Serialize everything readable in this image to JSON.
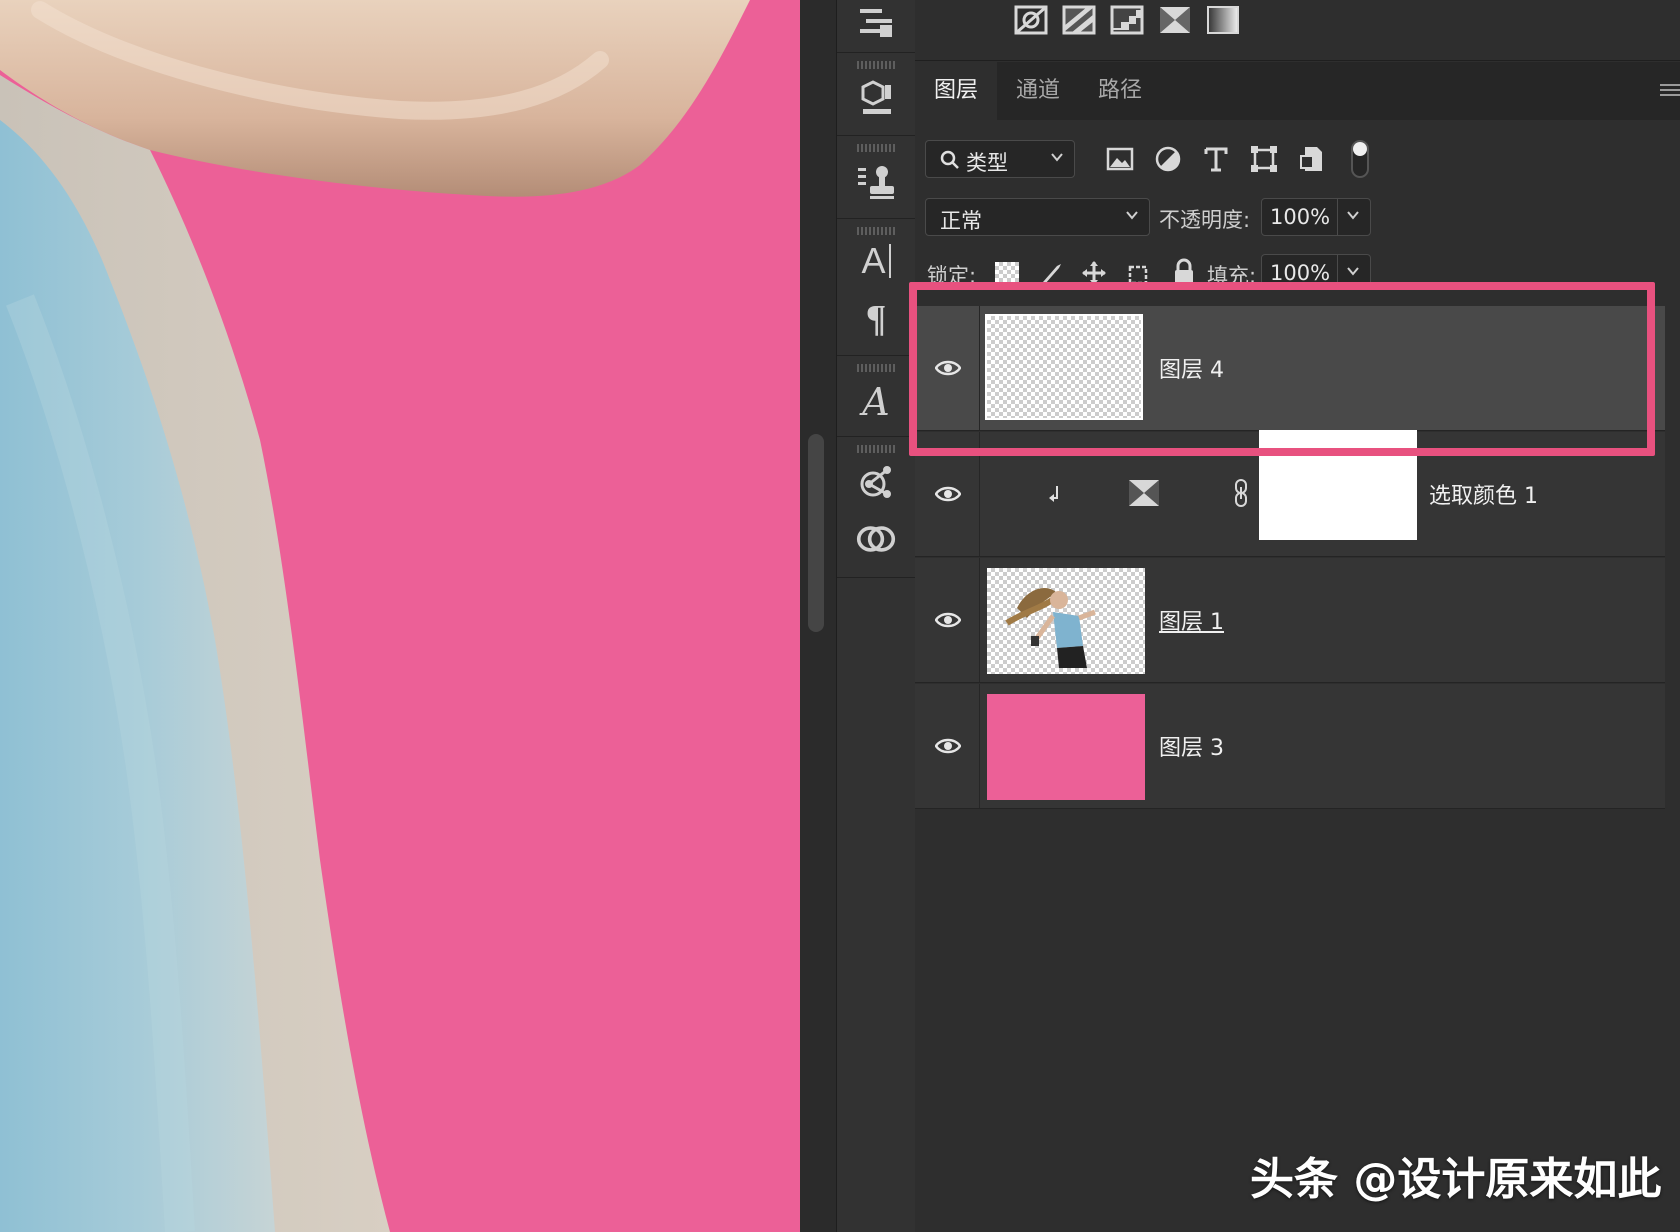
{
  "colors": {
    "canvas_bg": "#ec6097",
    "highlight": "#e8517f",
    "panel_bg": "#2e2e2e"
  },
  "adjustment_icons": [
    "exposure-icon",
    "gradient-map-icon",
    "posterize-icon",
    "channel-mixer-icon",
    "gradient-fill-icon"
  ],
  "tool_strip": [
    "properties-icon",
    "3d-icon",
    "clone-source-icon",
    "character-icon",
    "paragraph-icon",
    "glyphs-icon",
    "share-icon",
    "creative-cloud-icon"
  ],
  "tabs": {
    "layers": "图层",
    "channels": "通道",
    "paths": "路径"
  },
  "filter": {
    "kind_label": "类型",
    "icons": [
      "image-filter-icon",
      "adjustment-filter-icon",
      "type-filter-icon",
      "shape-filter-icon",
      "smart-object-filter-icon"
    ]
  },
  "blend": {
    "mode": "正常",
    "opacity_label": "不透明度:",
    "opacity_value": "100%"
  },
  "lock": {
    "lock_label": "锁定:",
    "fill_label": "填充:",
    "fill_value": "100%"
  },
  "layers": [
    {
      "name": "图层 4",
      "visible": true,
      "selected": true,
      "type": "empty"
    },
    {
      "name": "选取颜色 1",
      "visible": true,
      "selected": false,
      "type": "adjustment",
      "clipped": true
    },
    {
      "name": "图层 1",
      "visible": true,
      "selected": false,
      "type": "photo"
    },
    {
      "name": "图层 3",
      "visible": true,
      "selected": false,
      "type": "fill",
      "fill_color": "#ec6097"
    }
  ],
  "watermark": "头条 @设计原来如此"
}
